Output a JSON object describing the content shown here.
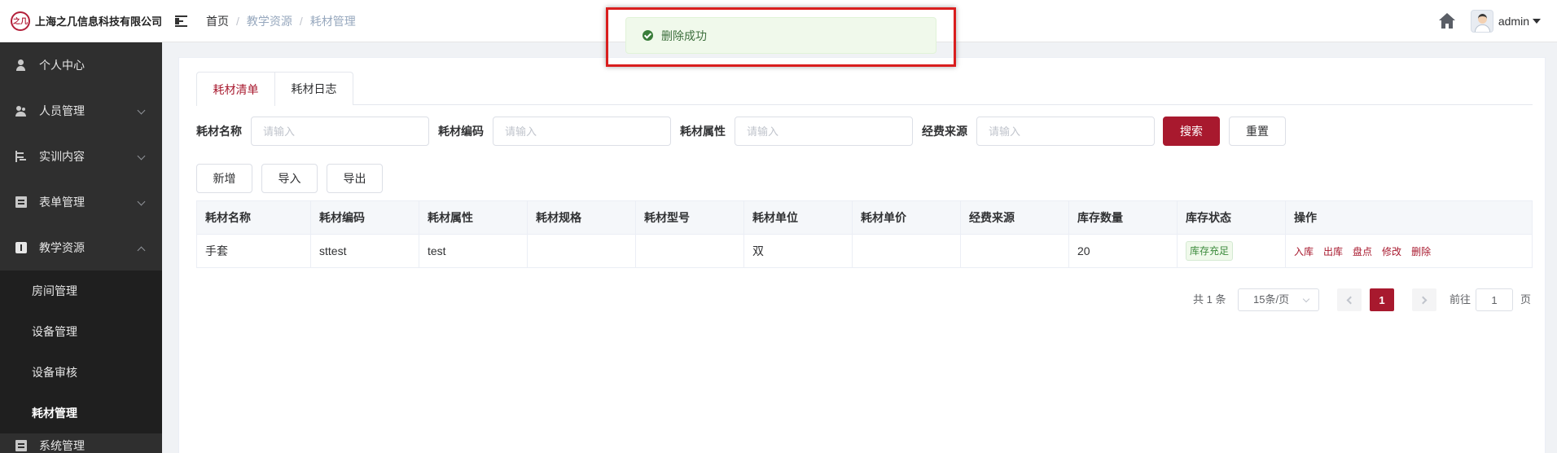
{
  "header": {
    "logo_mark": "之几",
    "company": "上海之几信息科技有限公司",
    "breadcrumb": [
      "首页",
      "教学资源",
      "耗材管理"
    ],
    "username": "admin"
  },
  "sidebar": {
    "items": [
      {
        "label": "个人中心",
        "icon": "user-icon"
      },
      {
        "label": "人员管理",
        "icon": "people-icon"
      },
      {
        "label": "实训内容",
        "icon": "tree-icon"
      },
      {
        "label": "表单管理",
        "icon": "form-icon"
      },
      {
        "label": "教学资源",
        "icon": "book-icon"
      },
      {
        "label": "系统管理",
        "icon": "settings-icon"
      }
    ],
    "submenu": [
      "房间管理",
      "设备管理",
      "设备审核",
      "耗材管理"
    ]
  },
  "tabs": [
    "耗材清单",
    "耗材日志"
  ],
  "filters": {
    "labels": [
      "耗材名称",
      "耗材编码",
      "耗材属性",
      "经费来源"
    ],
    "placeholder": "请输入",
    "search_label": "搜索",
    "reset_label": "重置"
  },
  "actions": [
    "新增",
    "导入",
    "导出"
  ],
  "table": {
    "columns": [
      "耗材名称",
      "耗材编码",
      "耗材属性",
      "耗材规格",
      "耗材型号",
      "耗材单位",
      "耗材单价",
      "经费来源",
      "库存数量",
      "库存状态",
      "操作"
    ],
    "rows": [
      {
        "name": "手套",
        "code": "sttest",
        "attr": "test",
        "spec": "",
        "model": "",
        "unit": "双",
        "price": "",
        "fund": "",
        "qty": "20",
        "status": "库存充足",
        "ops": [
          "入库",
          "出库",
          "盘点",
          "修改",
          "删除"
        ]
      }
    ]
  },
  "pagination": {
    "total": "共 1 条",
    "page_size": "15条/页",
    "current": "1",
    "goto_label": "前往",
    "goto_value": "1",
    "goto_suffix": "页"
  },
  "toast": {
    "message": "删除成功"
  },
  "colors": {
    "primary": "#a8192e",
    "sidebar_bg": "#2f2f2f",
    "submenu_bg": "#1f1f1f",
    "success": "#3a7d3a",
    "highlight": "#d91e1e"
  }
}
